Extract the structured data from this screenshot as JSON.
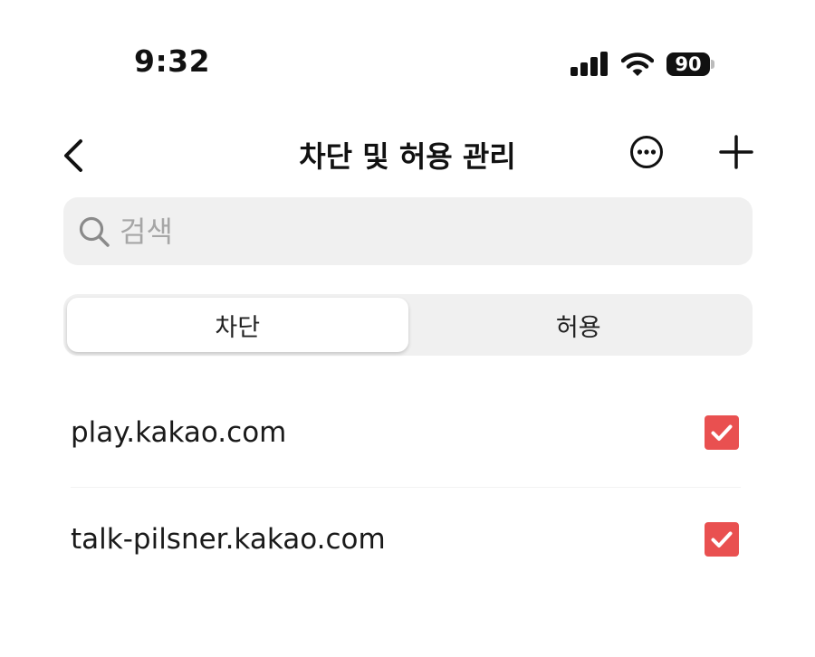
{
  "status_bar": {
    "time": "9:32",
    "battery_level": "90",
    "icons": [
      "signal-icon",
      "wifi-icon",
      "battery-icon"
    ]
  },
  "nav": {
    "title": "차단 및 허용 관리",
    "back_icon": "chevron-left-icon",
    "more_icon": "more-horizontal-circle-icon",
    "add_icon": "plus-icon"
  },
  "search": {
    "placeholder": "검색",
    "value": "",
    "icon": "search-icon"
  },
  "tabs": [
    {
      "label": "차단",
      "selected": true
    },
    {
      "label": "허용",
      "selected": false
    }
  ],
  "list": {
    "items": [
      {
        "domain": "play.kakao.com",
        "checked": true
      },
      {
        "domain": "talk-pilsner.kakao.com",
        "checked": true
      }
    ]
  },
  "colors": {
    "accent": "#e95050",
    "field_bg": "#f0f0f0",
    "text": "#111111",
    "placeholder": "#a6a6a6"
  }
}
